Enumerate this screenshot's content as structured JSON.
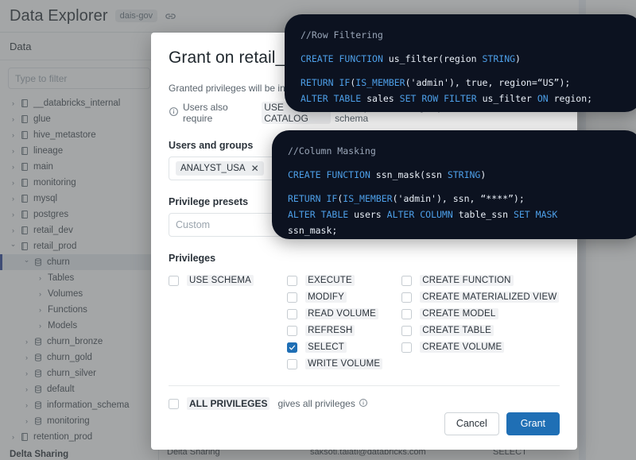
{
  "header": {
    "title": "Data Explorer",
    "workspace_badge": "dais-gov",
    "link_icon": "link-icon"
  },
  "sidebar": {
    "section_title": "Data",
    "filter_placeholder": "Type to filter",
    "catalogs": [
      {
        "label": "__databricks_internal",
        "icon": "catalog-icon",
        "chevron": "›",
        "indent": 0,
        "selected": false
      },
      {
        "label": "glue",
        "icon": "catalog-icon",
        "chevron": "›",
        "indent": 0,
        "selected": false
      },
      {
        "label": "hive_metastore",
        "icon": "catalog-icon",
        "chevron": "›",
        "indent": 0,
        "selected": false
      },
      {
        "label": "lineage",
        "icon": "catalog-icon",
        "chevron": "›",
        "indent": 0,
        "selected": false
      },
      {
        "label": "main",
        "icon": "catalog-icon",
        "chevron": "›",
        "indent": 0,
        "selected": false
      },
      {
        "label": "monitoring",
        "icon": "catalog-icon",
        "chevron": "›",
        "indent": 0,
        "selected": false
      },
      {
        "label": "mysql",
        "icon": "catalog-icon",
        "chevron": "›",
        "indent": 0,
        "selected": false
      },
      {
        "label": "postgres",
        "icon": "catalog-icon",
        "chevron": "›",
        "indent": 0,
        "selected": false
      },
      {
        "label": "retail_dev",
        "icon": "catalog-icon",
        "chevron": "›",
        "indent": 0,
        "selected": false
      },
      {
        "label": "retail_prod",
        "icon": "catalog-icon",
        "chevron": "⌄",
        "indent": 0,
        "selected": false
      },
      {
        "label": "churn",
        "icon": "schema-icon",
        "chevron": "⌄",
        "indent": 1,
        "selected": true
      },
      {
        "label": "Tables",
        "icon": "none",
        "chevron": "›",
        "indent": 2,
        "selected": false
      },
      {
        "label": "Volumes",
        "icon": "none",
        "chevron": "›",
        "indent": 2,
        "selected": false
      },
      {
        "label": "Functions",
        "icon": "none",
        "chevron": "›",
        "indent": 2,
        "selected": false
      },
      {
        "label": "Models",
        "icon": "none",
        "chevron": "›",
        "indent": 2,
        "selected": false
      },
      {
        "label": "churn_bronze",
        "icon": "schema-icon",
        "chevron": "›",
        "indent": 1,
        "selected": false
      },
      {
        "label": "churn_gold",
        "icon": "schema-icon",
        "chevron": "›",
        "indent": 1,
        "selected": false
      },
      {
        "label": "churn_silver",
        "icon": "schema-icon",
        "chevron": "›",
        "indent": 1,
        "selected": false
      },
      {
        "label": "default",
        "icon": "schema-icon",
        "chevron": "›",
        "indent": 1,
        "selected": false
      },
      {
        "label": "information_schema",
        "icon": "schema-icon",
        "chevron": "›",
        "indent": 1,
        "selected": false
      },
      {
        "label": "monitoring",
        "icon": "schema-icon",
        "chevron": "›",
        "indent": 1,
        "selected": false
      },
      {
        "label": "retention_prod",
        "icon": "catalog-icon",
        "chevron": "›",
        "indent": 0,
        "selected": false
      }
    ],
    "bottom_section": "Delta Sharing"
  },
  "background_row": {
    "name": "Delta Sharing",
    "principal": "saksoti.talati@databricks.com",
    "privilege": "SELECT"
  },
  "modal": {
    "title": "Grant on retail_prod.churn",
    "subtitle": "Granted privileges will be inherited by all current and future objects",
    "note_prefix": "Users also require",
    "note_code": "USE CATALOG",
    "note_suffix": "on the parent catalog to perform actions in this schema",
    "info_icon": "info-circle-icon",
    "users_label": "Users and groups",
    "user_chips": [
      {
        "label": "ANALYST_USA",
        "remove_icon": "close-icon"
      }
    ],
    "presets_label": "Privilege presets",
    "presets_value": "Custom",
    "privileges_label": "Privileges",
    "privilege_columns": [
      {
        "items": [
          {
            "label": "USE SCHEMA",
            "checked": false
          }
        ]
      },
      {
        "items": [
          {
            "label": "EXECUTE",
            "checked": false
          },
          {
            "label": "MODIFY",
            "checked": false
          },
          {
            "label": "READ VOLUME",
            "checked": false
          },
          {
            "label": "REFRESH",
            "checked": false
          },
          {
            "label": "SELECT",
            "checked": true
          },
          {
            "label": "WRITE VOLUME",
            "checked": false
          }
        ]
      },
      {
        "items": [
          {
            "label": "CREATE FUNCTION",
            "checked": false
          },
          {
            "label": "CREATE MATERIALIZED VIEW",
            "checked": false
          },
          {
            "label": "CREATE MODEL",
            "checked": false
          },
          {
            "label": "CREATE TABLE",
            "checked": false
          },
          {
            "label": "CREATE VOLUME",
            "checked": false
          }
        ]
      }
    ],
    "all_privileges": {
      "label": "ALL PRIVILEGES",
      "checked": false,
      "hint": "gives all privileges",
      "info_icon": "info-circle-icon"
    },
    "cancel_label": "Cancel",
    "grant_label": "Grant",
    "accent_color": "#1f6fb5"
  },
  "code_cards": [
    {
      "id": "row-filtering",
      "comment": "//Row Filtering",
      "lines": [
        "CREATE FUNCTION us_filter(region STRING)",
        "RETURN IF(IS_MEMBER('admin'), true, region=“US”);",
        "ALTER TABLE sales SET ROW FILTER us_filter ON region;"
      ],
      "bg": "#0c1220",
      "keyword_color": "#4d9fe8",
      "comment_color": "#9aa6b8"
    },
    {
      "id": "column-masking",
      "comment": "//Column Masking",
      "lines": [
        "CREATE FUNCTION ssn_mask(ssn STRING)",
        "RETURN IF(IS_MEMBER('admin'), ssn, “****”);",
        "ALTER TABLE users ALTER COLUMN table_ssn SET MASK",
        "ssn_mask;"
      ],
      "bg": "#0c1220",
      "keyword_color": "#4d9fe8",
      "comment_color": "#9aa6b8"
    }
  ]
}
